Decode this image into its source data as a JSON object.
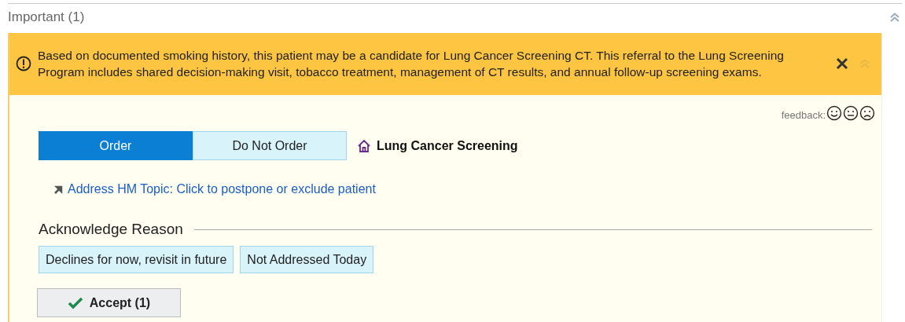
{
  "section": {
    "title": "Important (1)"
  },
  "alert": {
    "message": "Based on documented smoking history, this patient may be a candidate for Lung Cancer Screening CT. This referral to the Lung Screening Program includes shared decision-making visit, tobacco treatment, management of CT results, and annual follow-up screening exams."
  },
  "feedback": {
    "label": "feedback:"
  },
  "order_toggle": [
    {
      "label": "Order",
      "selected": true
    },
    {
      "label": "Do Not Order",
      "selected": false
    }
  ],
  "topic": {
    "title": "Lung Cancer Screening"
  },
  "hm_link": {
    "label": "Address HM Topic: Click to postpone or exclude patient"
  },
  "acknowledge": {
    "title": "Acknowledge Reason",
    "reasons": [
      {
        "label": "Declines for now, revisit in future",
        "selected": false
      },
      {
        "label": "Not Addressed Today",
        "selected": false
      }
    ]
  },
  "accept_button": {
    "label": "Accept (1)"
  }
}
